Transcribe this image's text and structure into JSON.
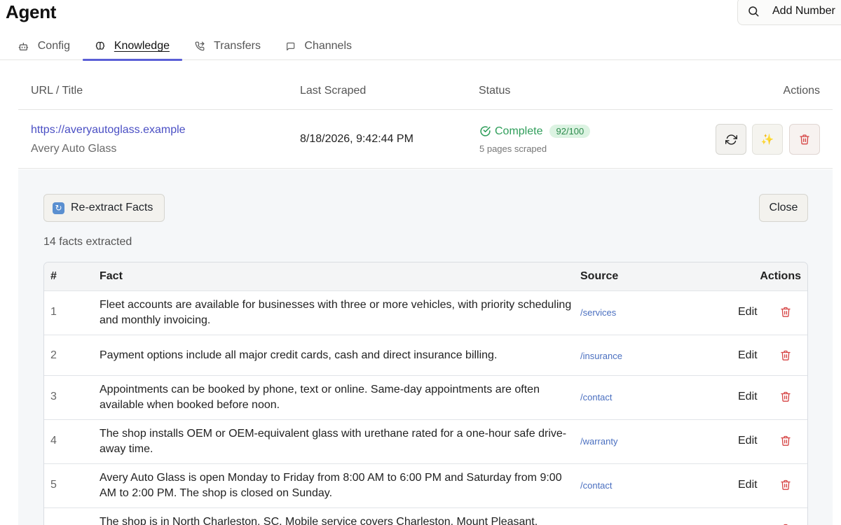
{
  "header": {
    "title": "Agent",
    "add_number_label": "Add Number"
  },
  "tabs": [
    {
      "label": "Config",
      "icon": "robot-icon",
      "active": false
    },
    {
      "label": "Knowledge",
      "icon": "brain-icon",
      "active": true
    },
    {
      "label": "Transfers",
      "icon": "phone-forward-icon",
      "active": false
    },
    {
      "label": "Channels",
      "icon": "chat-bubble-icon",
      "active": false
    }
  ],
  "sources": {
    "columns": {
      "url": "URL / Title",
      "scraped": "Last Scraped",
      "status": "Status",
      "actions": "Actions"
    },
    "row": {
      "url": "https://averyautoglass.example",
      "title": "Avery Auto Glass",
      "last_scraped": "8/18/2026, 9:42:44 PM",
      "status": "Complete",
      "score": "92/100",
      "pages": "5 pages scraped"
    }
  },
  "panel": {
    "reextract_label": "Re-extract Facts",
    "close_label": "Close",
    "facts_count": "14 facts extracted",
    "columns": {
      "num": "#",
      "fact": "Fact",
      "source": "Source",
      "actions": "Actions"
    },
    "edit_label": "Edit",
    "facts": [
      {
        "num": "1",
        "fact": "Fleet accounts are available for businesses with three or more vehicles, with priority scheduling and monthly invoicing.",
        "source": "/services"
      },
      {
        "num": "2",
        "fact": "Payment options include all major credit cards, cash and direct insurance billing.",
        "source": "/insurance"
      },
      {
        "num": "3",
        "fact": "Appointments can be booked by phone, text or online. Same-day appointments are often available when booked before noon.",
        "source": "/contact"
      },
      {
        "num": "4",
        "fact": "The shop installs OEM or OEM-equivalent glass with urethane rated for a one-hour safe drive-away time.",
        "source": "/warranty"
      },
      {
        "num": "5",
        "fact": "Avery Auto Glass is open Monday to Friday from 8:00 AM to 6:00 PM and Saturday from 9:00 AM to 2:00 PM. The shop is closed on Sunday.",
        "source": "/contact"
      },
      {
        "num": "",
        "fact": "The shop is in North Charleston, SC. Mobile service covers Charleston, Mount Pleasant,",
        "source": ""
      }
    ]
  },
  "colors": {
    "accent": "#5b5fd6",
    "link": "#4a4fc4",
    "success": "#2f9e5a",
    "danger": "#d64545"
  }
}
